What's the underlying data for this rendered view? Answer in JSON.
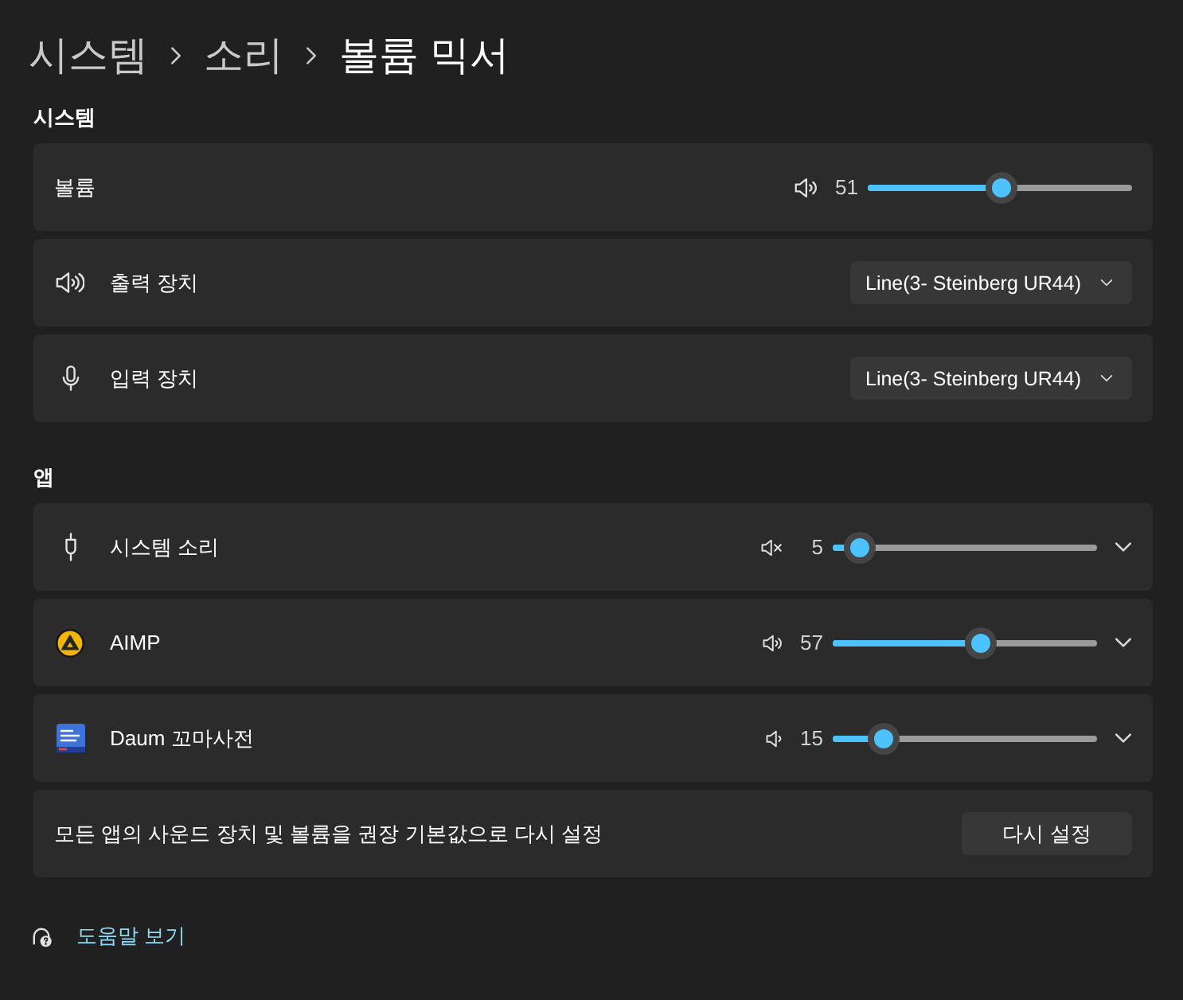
{
  "breadcrumb": [
    {
      "label": "시스템",
      "current": false
    },
    {
      "label": "소리",
      "current": false
    },
    {
      "label": "볼륨 믹서",
      "current": true
    }
  ],
  "system": {
    "heading": "시스템",
    "volume": {
      "label": "볼륨",
      "muted": false,
      "reading": "51",
      "level": 0.51
    },
    "devices": [
      {
        "kind": "output",
        "label": "출력 장치",
        "value": "Line(3- Steinberg UR44)"
      },
      {
        "kind": "input",
        "label": "입력 장치",
        "value": "Line(3- Steinberg UR44)"
      }
    ]
  },
  "apps": {
    "heading": "앱",
    "items": [
      {
        "kind": "plug",
        "name": "시스템 소리",
        "muted": true,
        "reading": "5",
        "level": 0.05,
        "expanded": false
      },
      {
        "kind": "aimp",
        "name": "AIMP",
        "muted": false,
        "reading": "57",
        "level": 0.57,
        "expanded": false
      },
      {
        "kind": "dictionary",
        "name": "Daum 꼬마사전",
        "muted": false,
        "reading": "15",
        "level": 0.15,
        "expanded": false
      }
    ]
  },
  "reset": {
    "text": "모든 앱의 사운드 장치 및 볼륨을 권장 기본값으로 다시 설정",
    "button": "다시 설정"
  },
  "help": {
    "label": "도움말 보기"
  }
}
